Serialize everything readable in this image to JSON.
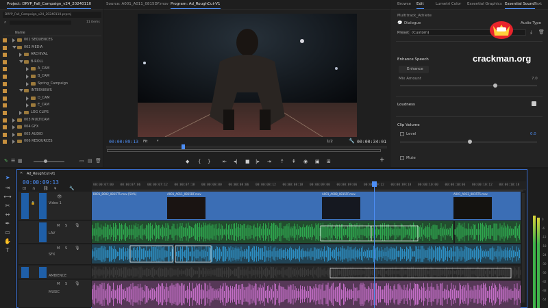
{
  "project": {
    "tab_label": "Project: DRYP_Fall_Campaign_v24_20240110",
    "breadcrumb": "DRYP_Fall_Campaign_v24_20240110.prproj",
    "item_count": "11 items",
    "column_name": "Name",
    "rows": [
      {
        "label": "001 SEQUENCES",
        "indent": 0,
        "open": false
      },
      {
        "label": "002 MEDIA",
        "indent": 0,
        "open": true
      },
      {
        "label": "ARCHIVAL",
        "indent": 1,
        "open": false
      },
      {
        "label": "B-ROLL",
        "indent": 1,
        "open": true
      },
      {
        "label": "A_CAM",
        "indent": 2,
        "open": false
      },
      {
        "label": "B_CAM",
        "indent": 2,
        "open": false
      },
      {
        "label": "Spring_Campaign",
        "indent": 2,
        "open": false
      },
      {
        "label": "INTERVIEWS",
        "indent": 1,
        "open": true
      },
      {
        "label": "D_CAM",
        "indent": 2,
        "open": false
      },
      {
        "label": "E_CAM",
        "indent": 2,
        "open": false
      },
      {
        "label": "LOG CLIPS",
        "indent": 1,
        "open": false
      },
      {
        "label": "003 MULTICAM",
        "indent": 0,
        "open": false
      },
      {
        "label": "004 GFX",
        "indent": 0,
        "open": false
      },
      {
        "label": "005 AUDIO",
        "indent": 0,
        "open": false
      },
      {
        "label": "006 RESOURCES",
        "indent": 0,
        "open": false
      }
    ]
  },
  "source_tab": "Source: A001_A011_0815DF.mov",
  "program": {
    "tab_label": "Program: Ad_RoughCut-V1",
    "timecode_left": "00:00:09:13",
    "fit": "Fit",
    "resolution": "1/2",
    "timecode_right": "00:00:34:01"
  },
  "right_tabs": [
    "Browse",
    "Edit",
    "Lumetri Color",
    "Essential Graphics",
    "Essential Sound",
    "Text"
  ],
  "essential_sound": {
    "subtitle": "Multitrack_Athlete",
    "dialogue_label": "Dialogue",
    "audio_type": "Audio Type",
    "preset_label": "Preset",
    "preset_value": "(Custom)",
    "enhance_speech": "Enhance Speech",
    "enhance_btn": "Enhance",
    "mix_amount": "Mix Amount",
    "mix_value": "7.0",
    "loudness": "Loudness",
    "clip_volume": "Clip Volume",
    "level": "Level",
    "level_value": "0.0",
    "mute": "Mute"
  },
  "watermark": "crackman.org",
  "timeline": {
    "sequence_tab": "Ad_RoughCut-V1",
    "timecode": "00:00:09:13",
    "ruler": [
      "00:00:07:00",
      "00:00:07:06",
      "00:00:07:12",
      "00:00:07:18",
      "00:00:08:00",
      "00:00:08:06",
      "00:00:08:12",
      "00:00:08:18",
      "00:00:09:00",
      "00:00:09:06",
      "00:00:09:12",
      "00:00:09:18",
      "00:00:10:00",
      "00:00:10:06",
      "00:00:10:12",
      "00:00:10:18"
    ],
    "tracks": [
      "Video 1",
      "LAV",
      "SFX",
      "AMBIENCE",
      "MUSIC"
    ],
    "clips": [
      "B001_B002_0815T5.mov [50%]",
      "A001_A011_0815DF.mov",
      "A001_A008_0815FF.mov",
      "A001_A013_0815T5.mov"
    ]
  },
  "meter_scale": [
    "0",
    "-6",
    "-12",
    "-18",
    "-24",
    "-30",
    "-36",
    "-42",
    "-48",
    "-54"
  ],
  "colors": {
    "accent": "#4d8ef5",
    "video_clip": "#3b6eb5",
    "lav": "#2fa84f",
    "sfx": "#2d8fc4",
    "music": "#c46ec7"
  }
}
